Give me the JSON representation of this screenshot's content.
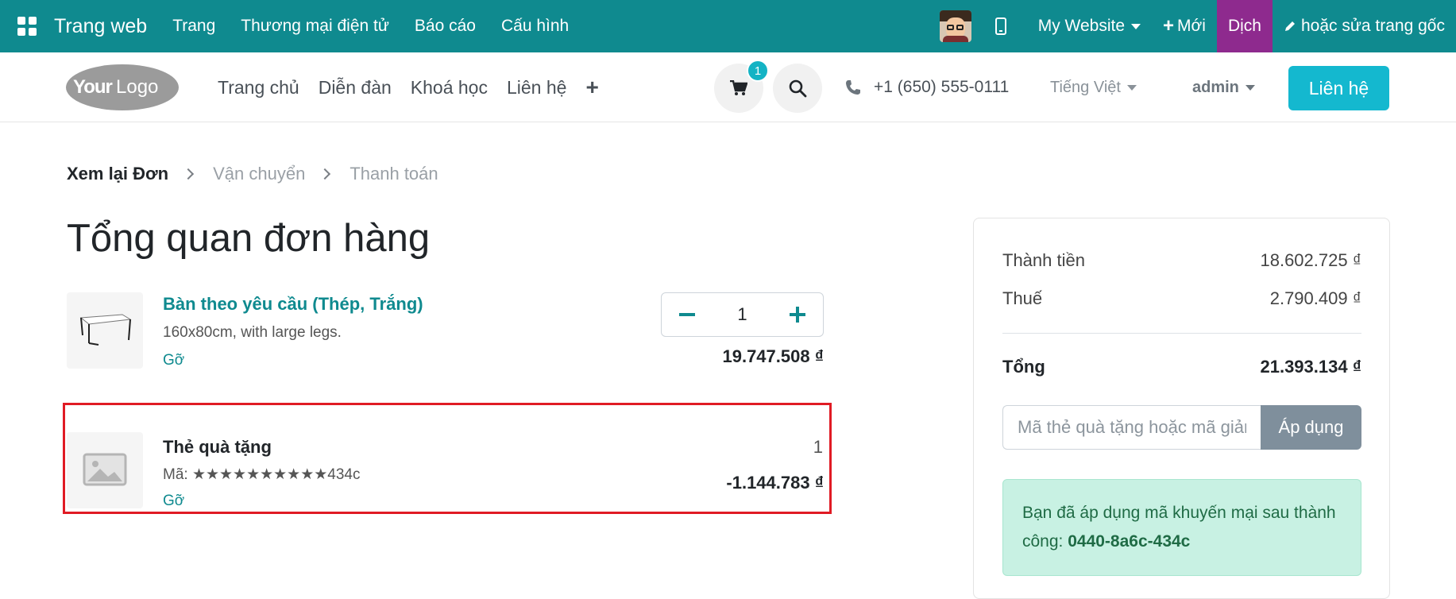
{
  "topbar": {
    "brand": "Trang web",
    "menus": [
      "Trang",
      "Thương mại điện tử",
      "Báo cáo",
      "Cấu hình"
    ],
    "website_selector": "My Website",
    "new_label": "Mới",
    "translate_label": "Dịch",
    "edit_label": "hoặc sửa trang gốc"
  },
  "header": {
    "nav": [
      "Trang chủ",
      "Diễn đàn",
      "Khoá học",
      "Liên hệ"
    ],
    "cart_count": "1",
    "phone": "+1 (650) 555-0111",
    "language": "Tiếng Việt",
    "user": "admin",
    "contact_button": "Liên hệ"
  },
  "breadcrumb": {
    "steps": [
      "Xem lại Đơn",
      "Vận chuyển",
      "Thanh toán"
    ]
  },
  "page_title": "Tổng quan đơn hàng",
  "lines": [
    {
      "name": "Bàn theo yêu cầu (Thép, Trắng)",
      "desc": "160x80cm, with large legs.",
      "remove": "Gỡ",
      "qty": "1",
      "price": "19.747.508 ₫"
    },
    {
      "name": "Thẻ quà tặng",
      "desc": "Mã: ★★★★★★★★★★434c",
      "remove": "Gỡ",
      "qty": "1",
      "price": "-1.144.783 ₫"
    }
  ],
  "summary": {
    "subtotal_label": "Thành tiền",
    "subtotal_value": "18.602.725 ₫",
    "tax_label": "Thuế",
    "tax_value": "2.790.409 ₫",
    "total_label": "Tổng",
    "total_value": "21.393.134 ₫",
    "coupon_placeholder": "Mã thẻ quà tặng hoặc mã giảm giá...",
    "apply_label": "Áp dụng",
    "alert_text": "Bạn đã áp dụng mã khuyến mại sau thành công: ",
    "alert_code": "0440-8a6c-434c"
  },
  "colors": {
    "topbar": "#0f8a8f",
    "translate": "#8e2a8e",
    "accent": "#14b8cf",
    "highlight": "#e01b24"
  }
}
